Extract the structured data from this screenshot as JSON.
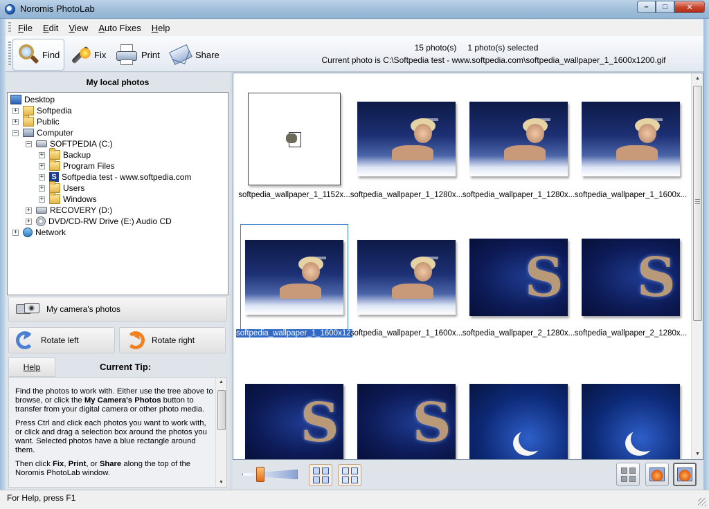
{
  "window": {
    "title": "Noromis PhotoLab"
  },
  "menu": [
    "File",
    "Edit",
    "View",
    "Auto Fixes",
    "Help"
  ],
  "toolbar": {
    "find": "Find",
    "fix": "Fix",
    "print": "Print",
    "share": "Share",
    "photo_count": "15 photo(s)",
    "selected_count": "1 photo(s) selected",
    "current_photo": "Current photo is  C:\\Softpedia test - www.softpedia.com\\softpedia_wallpaper_1_1600x1200.gif"
  },
  "left": {
    "title": "My local photos",
    "tree": [
      {
        "label": "Desktop",
        "icon": "desktop-icon"
      },
      {
        "label": "Softpedia",
        "icon": "user-folder-icon"
      },
      {
        "label": "Public",
        "icon": "folder-icon"
      },
      {
        "label": "Computer",
        "icon": "computer-icon"
      },
      {
        "label": "SOFTPEDIA (C:)",
        "icon": "drive-icon"
      },
      {
        "label": "Backup",
        "icon": "folder-icon"
      },
      {
        "label": "Program Files",
        "icon": "folder-icon"
      },
      {
        "label": "Softpedia test - www.softpedia.com",
        "icon": "softpedia-folder-icon"
      },
      {
        "label": "Users",
        "icon": "folder-icon"
      },
      {
        "label": "Windows",
        "icon": "folder-icon"
      },
      {
        "label": "RECOVERY (D:)",
        "icon": "drive-icon"
      },
      {
        "label": "DVD/CD-RW Drive (E:) Audio CD",
        "icon": "dvd-icon"
      },
      {
        "label": "Network",
        "icon": "network-icon"
      }
    ],
    "camera_button": "My camera's photos",
    "rotate_left": "Rotate left",
    "rotate_right": "Rotate right",
    "help_button": "Help",
    "tip_title": "Current Tip:",
    "tip": {
      "p1_a": "Find the photos to work with. Either use the tree above to browse, or click the ",
      "p1_b": "My Camera's Photos",
      "p1_c": " button to transfer from your digital camera or other photo media.",
      "p2": "Press Ctrl and click each photos you want to work with, or click and drag a selection box around the photos you want. Selected photos have a blue rectangle around them.",
      "p3_a": "Then click ",
      "p3_b": "Fix",
      "p3_c": ", ",
      "p3_d": "Print",
      "p3_e": ", or ",
      "p3_f": "Share",
      "p3_g": " along the top of the Noromis PhotoLab window."
    }
  },
  "photos": [
    {
      "label": "softpedia_wallpaper_1_1152x...",
      "kind": "gimp"
    },
    {
      "label": "softpedia_wallpaper_1_1280x...",
      "kind": "girl"
    },
    {
      "label": "softpedia_wallpaper_1_1280x...",
      "kind": "girl"
    },
    {
      "label": "softpedia_wallpaper_1_1600x...",
      "kind": "girl"
    },
    {
      "label": "softpedia_wallpaper_1_1600x1200.gif",
      "kind": "girl",
      "selected": true
    },
    {
      "label": "softpedia_wallpaper_1_1600x...",
      "kind": "girl"
    },
    {
      "label": "softpedia_wallpaper_2_1280x...",
      "kind": "s"
    },
    {
      "label": "softpedia_wallpaper_2_1280x...",
      "kind": "s"
    },
    {
      "label": "",
      "kind": "s"
    },
    {
      "label": "",
      "kind": "s"
    },
    {
      "label": "",
      "kind": "moon"
    },
    {
      "label": "",
      "kind": "moon"
    }
  ],
  "status": "For Help, press F1",
  "colors": {
    "selection": "#3169c6",
    "panel": "#dfe4ea"
  }
}
